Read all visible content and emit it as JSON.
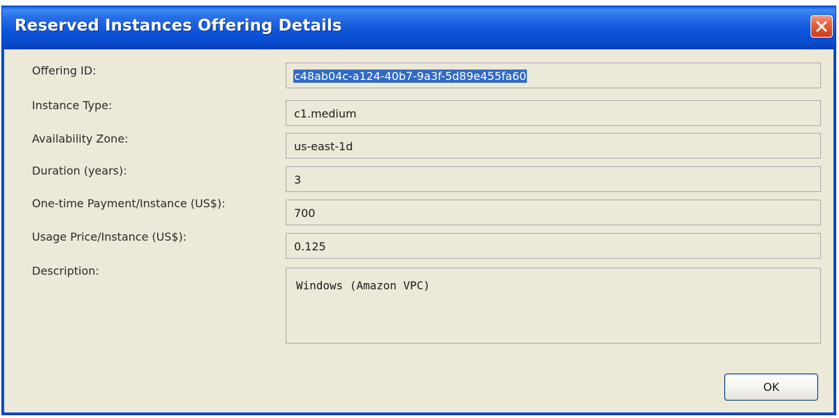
{
  "window": {
    "title": "Reserved Instances Offering Details"
  },
  "fields": [
    {
      "label": "Offering ID:",
      "value": "c48ab04c-a124-40b7-9a3f-5d89e455fa60"
    },
    {
      "label": "Instance Type:",
      "value": "c1.medium"
    },
    {
      "label": "Availability Zone:",
      "value": "us-east-1d"
    },
    {
      "label": "Duration (years):",
      "value": "3"
    },
    {
      "label": "One-time Payment/Instance (US$):",
      "value": "700"
    },
    {
      "label": "Usage Price/Instance (US$):",
      "value": "0.125"
    }
  ],
  "description": {
    "label": "Description:",
    "value": "Windows (Amazon VPC)"
  },
  "buttons": {
    "ok_label": "OK"
  },
  "colors": {
    "titlebar": "#0b54da",
    "dialog_bg": "#ece9d8",
    "selection": "#316ac5",
    "close_button": "#e6613e"
  }
}
